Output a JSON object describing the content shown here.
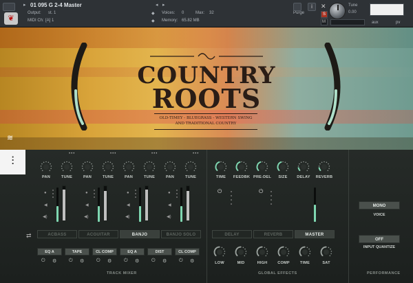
{
  "header": {
    "instrument_name": "01 095 G 2-4 Master",
    "output_label": "Output:",
    "output_value": "st. 1",
    "voices_label": "Voices:",
    "voices_value": "0",
    "max_label": "Max:",
    "max_value": "32",
    "purge_label": "Purge",
    "midi_label": "MIDI Ch:",
    "midi_value": "[A] 1",
    "memory_label": "Memory:",
    "memory_value": "65.82 MB",
    "tune_label": "Tune",
    "tune_value": "0.00",
    "s_label": "S",
    "m_label": "M",
    "lr_label": "L   R",
    "aux_label": "aux",
    "pv_label": "pv"
  },
  "artwork": {
    "logo_line1": "COUNTRY",
    "logo_line2": "ROOTS",
    "tagline": "OLD-TIMEY - BLUEGRASS - WESTERN SWING AND TRADITIONAL COUNTRY"
  },
  "track_mixer": {
    "title": "TRACK MIXER",
    "channels": [
      {
        "pan": "PAN",
        "tune": "TUNE",
        "fader": 0.45,
        "meter": 0.9
      },
      {
        "pan": "PAN",
        "tune": "TUNE",
        "fader": 0.45,
        "meter": 0.85
      },
      {
        "pan": "PAN",
        "tune": "TUNE",
        "fader": 0.45,
        "meter": 0.9
      },
      {
        "pan": "PAN",
        "tune": "TUNE",
        "fader": 0.45,
        "meter": 0.85
      }
    ],
    "tabs": [
      "ACBASS",
      "ACGUITAR",
      "BANJO",
      "BANJO SOLO"
    ],
    "active_tab": "BANJO",
    "fx_slots": [
      "EQ A",
      "TAPE",
      "CL COMP",
      "EQ A",
      "DIST",
      "CL COMP"
    ]
  },
  "global_effects": {
    "title": "GLOBAL EFFECTS",
    "knobs": [
      "TIME",
      "FEEDBK",
      "PRE-DEL",
      "SIZE",
      "DELAY",
      "REVERB"
    ],
    "tabs": [
      "DELAY",
      "REVERB",
      "MASTER"
    ],
    "active_tab": "MASTER",
    "master_fader": 0.5,
    "eq_knobs": [
      "LOW",
      "MID",
      "HIGH",
      "COMP",
      "TIME",
      "SAT"
    ]
  },
  "performance": {
    "title": "PERFORMANCE",
    "voice_value": "MONO",
    "voice_label": "VOICE",
    "quantize_value": "OFF",
    "quantize_label": "INPUT QUANTIZE"
  },
  "colors": {
    "accent": "#7fd7b1",
    "panel": "#1f2421"
  },
  "icons": [
    "wrench-icon",
    "instrument-logo-icon",
    "camera-icon",
    "info-icon",
    "close-icon",
    "tune-knob-icon",
    "waveform-icon",
    "mixer-sliders-icon",
    "link-arrows-icon",
    "gear-icon",
    "power-icon"
  ]
}
